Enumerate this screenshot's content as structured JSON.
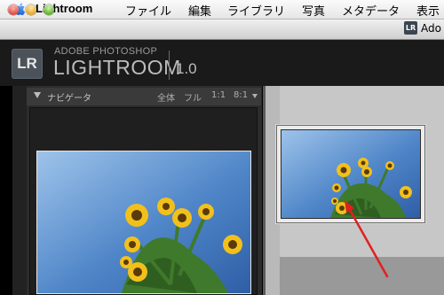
{
  "menubar": {
    "app_name": "Lightroom",
    "menus": [
      "ファイル",
      "編集",
      "ライブラリ",
      "写真",
      "メタデータ",
      "表示"
    ]
  },
  "window": {
    "dock_label": "Ado"
  },
  "lr_header": {
    "badge": "LR",
    "brand_top": "ADOBE PHOTOSHOP",
    "brand_main": "LIGHTROOM",
    "version": "1.0"
  },
  "navigator": {
    "title": "ナビゲータ",
    "zoom_options": [
      "全体",
      "フル",
      "1:1",
      "8:1"
    ]
  },
  "colors": {
    "sky": "#3a6fb8",
    "petal": "#f2c01c",
    "center": "#5a3a0a",
    "leaf": "#3f7a2c",
    "arrow": "#e02020"
  }
}
